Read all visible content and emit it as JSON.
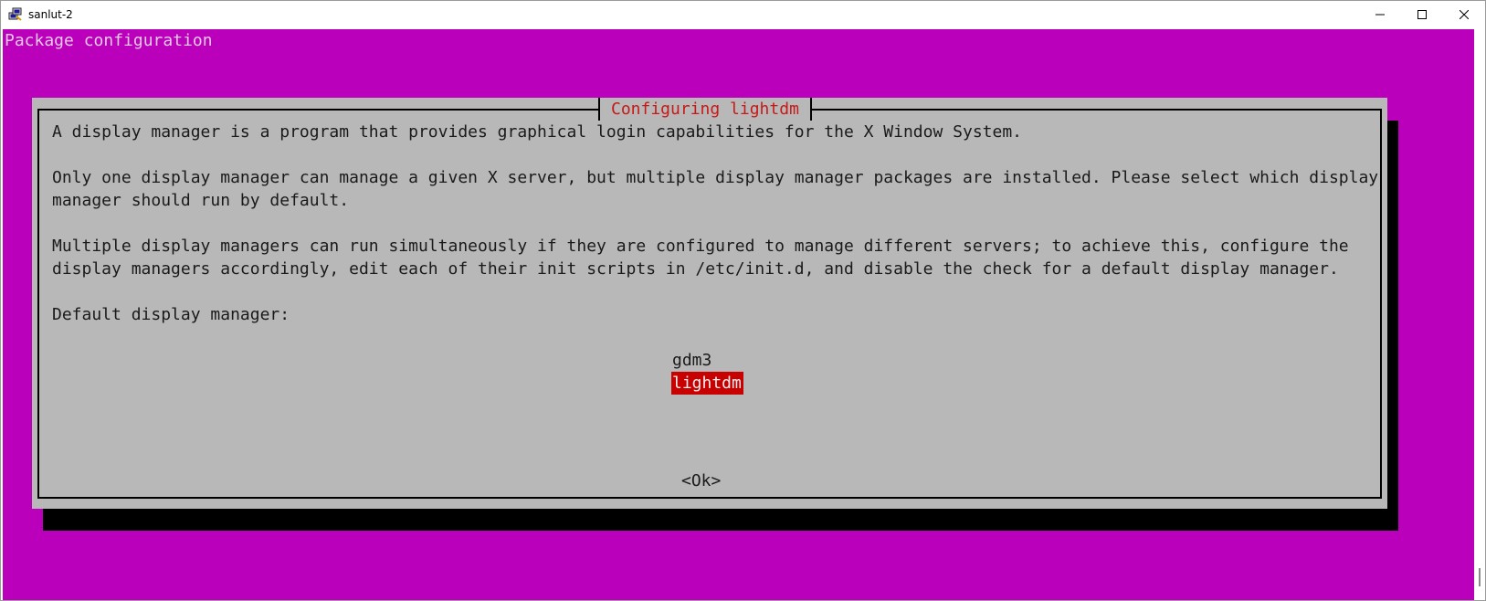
{
  "window": {
    "title": "sanlut-2"
  },
  "terminal": {
    "header": "Package configuration"
  },
  "dialog": {
    "title": "Configuring lightdm",
    "lines": [
      "A display manager is a program that provides graphical login capabilities for the X Window System.",
      "Only one display manager can manage a given X server, but multiple display manager packages are installed. Please select which display",
      "manager should run by default.",
      "Multiple display managers can run simultaneously if they are configured to manage different servers; to achieve this, configure the",
      "display managers accordingly, edit each of their init scripts in /etc/init.d, and disable the check for a default display manager.",
      "Default display manager:"
    ],
    "options": [
      {
        "label": "gdm3",
        "selected": false
      },
      {
        "label": "lightdm",
        "selected": true
      }
    ],
    "ok_label": "<Ok>"
  },
  "colors": {
    "terminal_bg": "#bb00bb",
    "dialog_bg": "#b8b8b8",
    "title_fg": "#c81818",
    "selected_bg": "#c80000"
  },
  "icons": {
    "app": "putty-icon",
    "minimize": "minimize-icon",
    "maximize": "maximize-icon",
    "close": "close-icon"
  }
}
